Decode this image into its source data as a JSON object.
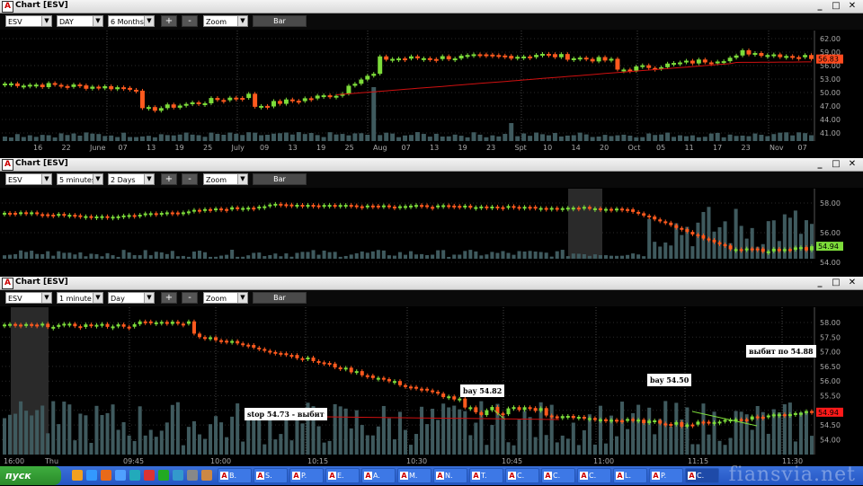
{
  "windows": [
    {
      "title": "Chart [ESV]",
      "symbol": "ESV",
      "interval": "DAY",
      "range": "6 Months",
      "zoom": "Zoom",
      "bar_label": "Bar",
      "plus": "+",
      "minus": "-",
      "last_price": "56.83",
      "y_ticks": [
        "62.00",
        "59.00",
        "56.00",
        "53.00",
        "50.00",
        "47.00",
        "44.00",
        "41.00"
      ],
      "x_ticks": [
        "16",
        "22",
        "June",
        "07",
        "13",
        "19",
        "25",
        "July",
        "09",
        "13",
        "19",
        "25",
        "Aug",
        "07",
        "13",
        "19",
        "23",
        "Spt",
        "10",
        "14",
        "20",
        "Oct",
        "05",
        "11",
        "17",
        "23",
        "Nov",
        "07"
      ]
    },
    {
      "title": "Chart [ESV]",
      "symbol": "ESV",
      "interval": "5 minutes",
      "range": "2 Days",
      "zoom": "Zoom",
      "bar_label": "Bar",
      "plus": "+",
      "minus": "-",
      "last_price": "54.94",
      "y_ticks": [
        "58.00",
        "56.00",
        "54.00"
      ]
    },
    {
      "title": "Chart [ESV]",
      "symbol": "ESV",
      "interval": "1 minute",
      "range": "Day",
      "zoom": "Zoom",
      "bar_label": "Bar",
      "plus": "+",
      "minus": "-",
      "last_price": "54.94",
      "y_ticks": [
        "58.00",
        "57.50",
        "57.00",
        "56.50",
        "56.00",
        "55.50",
        "55.00",
        "54.50",
        "54.00"
      ],
      "x_ticks": [
        "16:00",
        "Thu",
        "09:45",
        "10:00",
        "10:15",
        "10:30",
        "10:45",
        "11:00",
        "11:15",
        "11:30"
      ],
      "annotations": {
        "stop": "stop 54.73 - выбит",
        "bay1": "bay 54.82",
        "bay2": "bay 54.50",
        "exit": "выбит по 54.88"
      }
    }
  ],
  "taskbar": {
    "start": "пуск",
    "items": [
      "В.",
      "S.",
      "P.",
      "E.",
      "A.",
      "M.",
      "N.",
      "T.",
      "C.",
      "C.",
      "C.",
      "L.",
      "P.",
      "C."
    ]
  },
  "watermark": "fiansvia.net",
  "colors": {
    "up": "#7ddc3a",
    "down": "#ff5a1e",
    "ma": "#d01010",
    "volume": "#3f5a5e"
  }
}
